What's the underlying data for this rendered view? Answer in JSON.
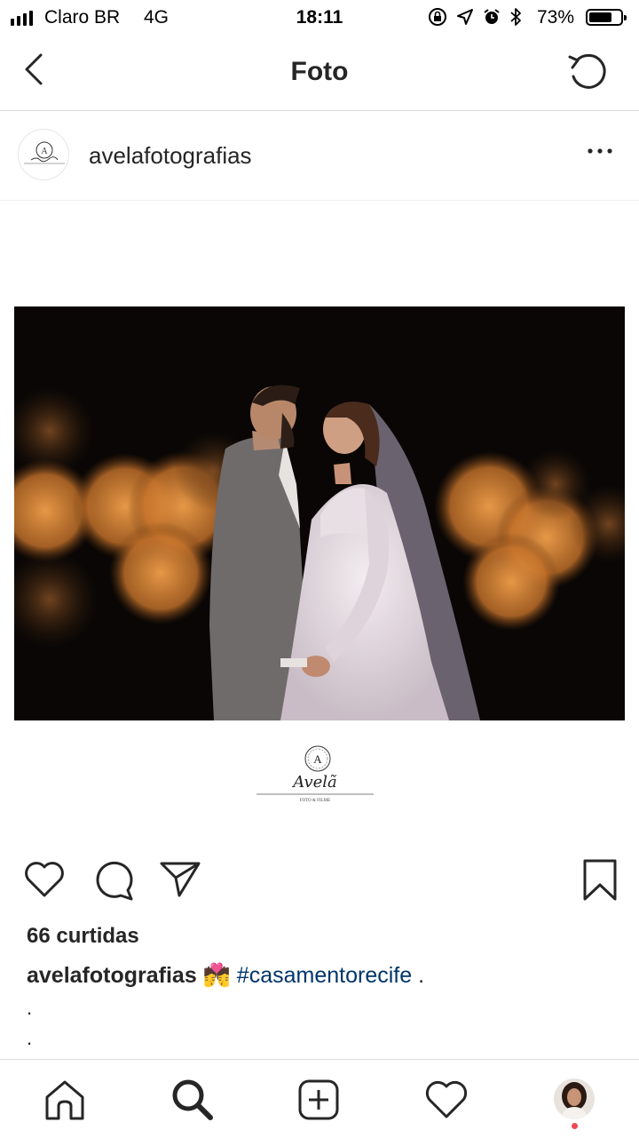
{
  "status_bar": {
    "carrier": "Claro BR",
    "network": "4G",
    "time": "18:11",
    "battery": "73%",
    "battery_level": 0.73,
    "icons": [
      "signal-icon",
      "orientation-lock-icon",
      "location-arrow-icon",
      "alarm-icon",
      "bluetooth-icon",
      "battery-icon"
    ]
  },
  "nav": {
    "title": "Foto",
    "back_icon": "chevron-left-icon",
    "refresh_icon": "refresh-icon"
  },
  "post": {
    "username": "avelafotografias",
    "more_icon": "more-dots-icon",
    "watermark_letter": "A",
    "watermark_script": "Avelã",
    "watermark_sub": "FOTO & FILME",
    "likes": "66 curtidas",
    "caption": {
      "username": "avelafotografias",
      "emoji": "💏",
      "hashtag": "#casamentorecife",
      "trailing": " .",
      "lines": [
        ".",
        "."
      ]
    }
  },
  "actions": {
    "like_icon": "heart-icon",
    "comment_icon": "comment-icon",
    "share_icon": "share-paper-plane-icon",
    "save_icon": "bookmark-icon"
  },
  "tabbar": {
    "items": [
      "home-icon",
      "search-icon",
      "new-post-icon",
      "activity-heart-icon",
      "profile-avatar"
    ]
  },
  "colors": {
    "text": "#262626",
    "hashtag": "#003569",
    "divider": "#dbdbdb",
    "notification": "#ed4956"
  }
}
